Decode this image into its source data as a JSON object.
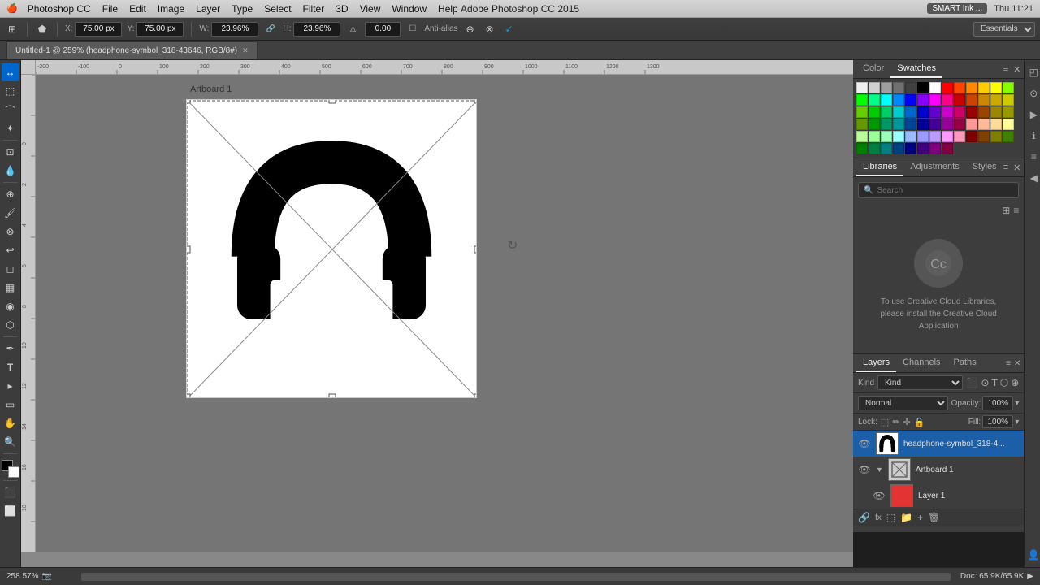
{
  "app": {
    "name": "Adobe Photoshop CC 2015",
    "title": "Adobe Photoshop CC 2015",
    "time": "Thu 11:21",
    "smart_ink": "SMART Ink ..."
  },
  "menu": {
    "apple": "🍎",
    "items": [
      "Photoshop CC",
      "File",
      "Edit",
      "Image",
      "Layer",
      "Type",
      "Select",
      "Filter",
      "3D",
      "View",
      "Window",
      "Help"
    ]
  },
  "options_bar": {
    "x_label": "X:",
    "x_value": "75.00 px",
    "y_label": "Y:",
    "y_value": "75.00 px",
    "w_label": "W:",
    "w_value": "23.96%",
    "h_label": "H:",
    "h_value": "23.96%",
    "angle_value": "0.00",
    "anti_alias": "Anti-alias",
    "essentials": "Essentials"
  },
  "tab": {
    "name": "Untitled-1 @ 259% (headphone-symbol_318-43646, RGB/8#)"
  },
  "canvas": {
    "artboard_label": "Artboard 1",
    "zoom": "258.57%",
    "doc_info": "Doc: 65.9K/65.9K"
  },
  "swatches": {
    "color_tab": "Color",
    "swatches_tab": "Swatches",
    "colors": [
      "#f0f0f0",
      "#d0d0d0",
      "#a0a0a0",
      "#707070",
      "#404040",
      "#000000",
      "#ffffff",
      "#ff0000",
      "#ff4400",
      "#ff8800",
      "#ffcc00",
      "#ffff00",
      "#88ff00",
      "#00ff00",
      "#00ff88",
      "#00ffff",
      "#0088ff",
      "#0000ff",
      "#8800ff",
      "#ff00ff",
      "#ff0088",
      "#cc0000",
      "#cc4400",
      "#cc8800",
      "#ccaa00",
      "#cccc00",
      "#66cc00",
      "#00cc00",
      "#00cc66",
      "#00cccc",
      "#0066cc",
      "#0000cc",
      "#6600cc",
      "#cc00cc",
      "#cc0066",
      "#990000",
      "#994400",
      "#998800",
      "#999900",
      "#669900",
      "#009900",
      "#009966",
      "#009999",
      "#004499",
      "#000099",
      "#440099",
      "#990099",
      "#990044",
      "#ff9999",
      "#ffbb99",
      "#ffdd99",
      "#ffff99",
      "#bbff99",
      "#99ff99",
      "#99ffbb",
      "#99ffff",
      "#99bbff",
      "#9999ff",
      "#bb99ff",
      "#ff99ff",
      "#ff99bb",
      "#800000",
      "#804000",
      "#808000",
      "#408000",
      "#008000",
      "#008040",
      "#008080",
      "#004080",
      "#000080",
      "#400080",
      "#800080",
      "#800040"
    ]
  },
  "libraries": {
    "tab_libraries": "Libraries",
    "tab_adjustments": "Adjustments",
    "tab_styles": "Styles",
    "cc_message": "To use Creative Cloud Libraries, please install the Creative Cloud Application"
  },
  "layers": {
    "tab_layers": "Layers",
    "tab_channels": "Channels",
    "tab_paths": "Paths",
    "kind_label": "Kind",
    "blend_mode": "Normal",
    "opacity_label": "Opacity:",
    "opacity_value": "100%",
    "lock_label": "Lock:",
    "fill_label": "Fill:",
    "fill_value": "100%",
    "layer_items": [
      {
        "name": "headphone-symbol_318-4...",
        "type": "smart",
        "visible": true
      },
      {
        "name": "Artboard 1",
        "type": "artboard",
        "visible": true,
        "expanded": true
      },
      {
        "name": "Layer 1",
        "type": "color",
        "color": "#e33333",
        "visible": true
      }
    ]
  }
}
